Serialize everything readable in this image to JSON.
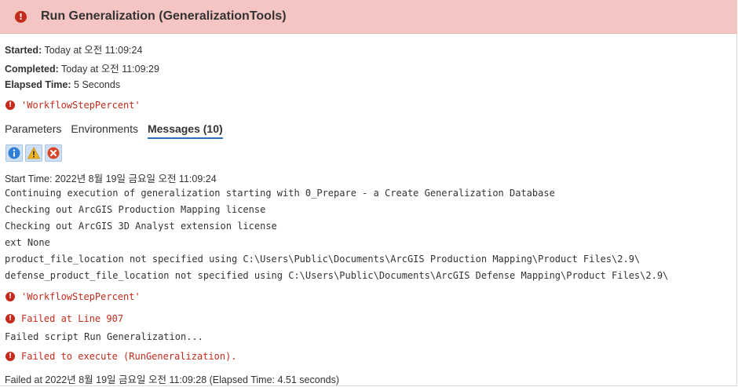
{
  "header": {
    "title": "Run Generalization (GeneralizationTools)"
  },
  "meta": {
    "started_label": "Started:",
    "started_value": "Today at 오전 11:09:24",
    "completed_label": "Completed:",
    "completed_value": "Today at 오전 11:09:29",
    "elapsed_label": "Elapsed Time:",
    "elapsed_value": "5 Seconds"
  },
  "summary_error": "'WorkflowStepPercent'",
  "tabs": [
    {
      "label": "Parameters"
    },
    {
      "label": "Environments"
    },
    {
      "label": "Messages (10)"
    }
  ],
  "filters": {
    "info_icon": "info-icon",
    "warning_icon": "warning-icon",
    "error_icon": "error-icon"
  },
  "messages": {
    "m0": "Start Time: 2022년 8월 19일 금요일 오전 11:09:24",
    "m1": "Continuing execution of generalization starting with 0_Prepare - a Create Generalization Database",
    "m2": "Checking out ArcGIS Production Mapping license",
    "m3": "Checking out ArcGIS 3D Analyst extension license",
    "m4": "ext None",
    "m5": "product_file_location not specified using C:\\Users\\Public\\Documents\\ArcGIS Production Mapping\\Product Files\\2.9\\",
    "m6": "defense_product_file_location not specified using C:\\Users\\Public\\Documents\\ArcGIS Defense Mapping\\Product Files\\2.9\\",
    "e1": "'WorkflowStepPercent'",
    "e2": "Failed at Line 907",
    "m7": "Failed script Run Generalization...",
    "e3": "Failed to execute (RunGeneralization).",
    "m8": "Failed at 2022년 8월 19일 금요일 오전 11:09:28 (Elapsed Time: 4.51 seconds)"
  },
  "colors": {
    "header_bg": "#f4c5c3",
    "error_red": "#c42b1c",
    "tab_underline": "#2a72c4"
  }
}
